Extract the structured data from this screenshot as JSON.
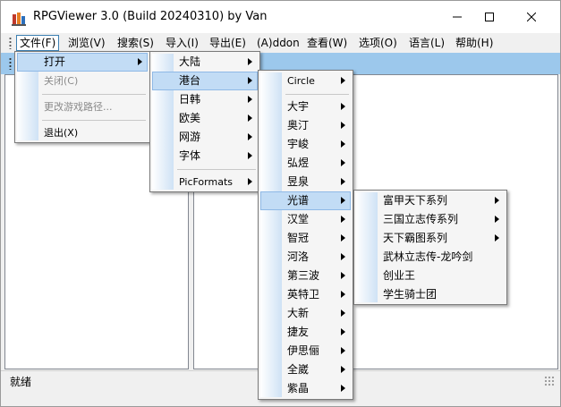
{
  "window": {
    "title": "RPGViewer 3.0 (Build 20240310) by Van",
    "minimize_icon": "minimize-icon",
    "maximize_icon": "maximize-icon",
    "close_icon": "close-icon",
    "app_icon": "rpgviewer-app-icon"
  },
  "menubar": {
    "items": [
      {
        "label": "文件(F)"
      },
      {
        "label": "浏览(V)"
      },
      {
        "label": "搜索(S)"
      },
      {
        "label": "导入(I)"
      },
      {
        "label": "导出(E)"
      },
      {
        "label": "(A)ddon"
      },
      {
        "label": "查看(W)"
      },
      {
        "label": "选项(O)"
      },
      {
        "label": "语言(L)"
      },
      {
        "label": "帮助(H)"
      }
    ]
  },
  "file_menu": {
    "open": "打开",
    "close": "关闭(C)",
    "change_path": "更改游戏路径...",
    "exit": "退出(X)"
  },
  "open_submenu": {
    "items": [
      "大陆",
      "港台",
      "日韩",
      "欧美",
      "网游",
      "字体"
    ],
    "picformats": "PicFormats"
  },
  "hktw_submenu": {
    "circle": "Circle",
    "items": [
      "大宇",
      "奥汀",
      "宇峻",
      "弘煜",
      "昱泉",
      "光谱",
      "汉堂",
      "智冠",
      "河洛",
      "第三波",
      "英特卫",
      "大新",
      "捷友",
      "伊思俪",
      "全崴",
      "紫晶"
    ]
  },
  "guangpu_submenu": {
    "items": [
      "富甲天下系列",
      "三国立志传系列",
      "天下霸图系列",
      "武林立志传-龙吟剑",
      "创业王",
      "学生骑士团"
    ]
  },
  "statusbar": {
    "text": "就绪"
  },
  "colors": {
    "toolbar": "#9cc8ec",
    "menu_highlight": "#c2dcf5",
    "menu_highlight_border": "#8fb9e6"
  }
}
